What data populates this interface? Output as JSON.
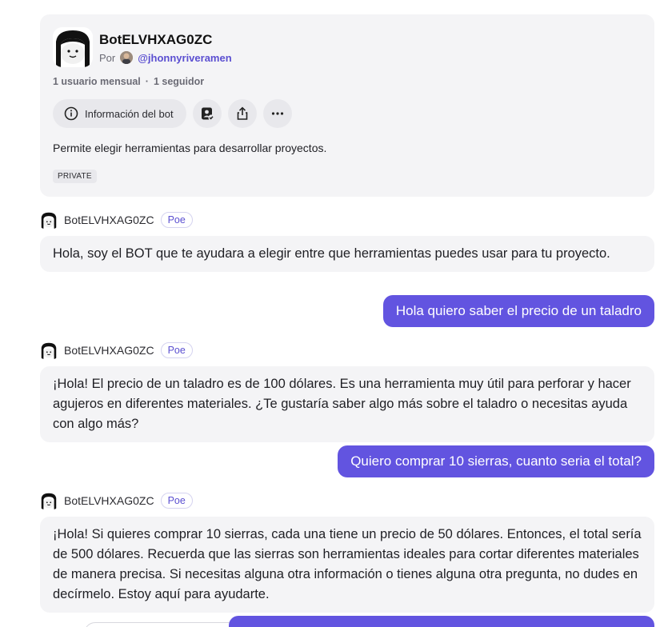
{
  "bot": {
    "name": "BotELVHXAG0ZC",
    "by_label": "Por",
    "creator_handle": "@jhonnyriveramen",
    "stats": {
      "users": "1 usuario mensual",
      "separator": "·",
      "followers": "1 seguidor"
    },
    "info_button_label": "Información del bot",
    "description": "Permite elegir herramientas para desarrollar proyectos.",
    "visibility_badge": "PRIVATE"
  },
  "messages": [
    {
      "role": "bot",
      "sender": "BotELVHXAG0ZC",
      "badge": "Poe",
      "text": "Hola, soy el BOT que te ayudara a elegir entre que herramientas puedes usar para tu proyecto."
    },
    {
      "role": "user",
      "text": "Hola quiero saber el precio de un taladro"
    },
    {
      "role": "bot",
      "sender": "BotELVHXAG0ZC",
      "badge": "Poe",
      "text": "¡Hola! El precio de un taladro es de 100 dólares. Es una herramienta muy útil para perforar y hacer agujeros en diferentes materiales. ¿Te gustaría saber algo más sobre el taladro o necesitas ayuda con algo más?"
    },
    {
      "role": "user",
      "text": "Quiero comprar 10 sierras, cuanto seria el total?"
    },
    {
      "role": "bot",
      "sender": "BotELVHXAG0ZC",
      "badge": "Poe",
      "text": "¡Hola! Si quieres comprar 10 sierras, cada una tiene un precio de 50 dólares. Entonces, el total sería de 500 dólares. Recuerda que las sierras son herramientas ideales para cortar diferentes materiales de manera precisa. Si necesitas alguna otra información o tienes alguna otra pregunta, no dudes en decírmelo. Estoy aquí para ayudarte."
    }
  ],
  "colors": {
    "accent": "#6254e0",
    "link": "#5b4fd1",
    "card_bg": "#f4f4f6"
  },
  "icons": {
    "info_button": "info-circle-icon",
    "follow_button": "person-check-icon",
    "share_button": "share-icon",
    "more_button": "more-horizontal-icon"
  }
}
